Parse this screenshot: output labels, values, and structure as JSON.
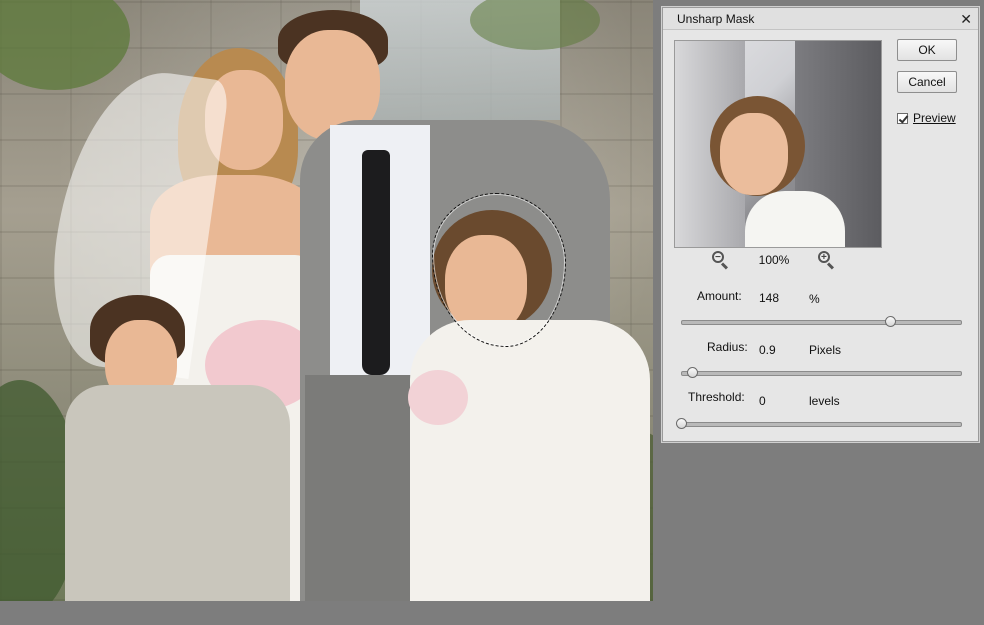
{
  "dialog": {
    "title": "Unsharp Mask",
    "close_glyph": "✕",
    "ok_label": "OK",
    "cancel_label": "Cancel",
    "preview_label": "Preview",
    "preview_checked": true,
    "zoom_level": "100%"
  },
  "params": {
    "amount": {
      "label": "Amount:",
      "value": "148",
      "unit": "%",
      "fraction": 0.75
    },
    "radius": {
      "label": "Radius:",
      "value": "0.9",
      "unit": "Pixels",
      "fraction": 0.04
    },
    "threshold": {
      "label": "Threshold:",
      "value": "0",
      "unit": "levels",
      "fraction": 0.0
    }
  },
  "icons": {
    "zoom_out": "zoom-out-icon",
    "zoom_in": "zoom-in-icon",
    "close": "close-icon"
  },
  "colors": {
    "dialog_bg": "#e6e6e6",
    "workspace_bg": "#7d7d7d"
  }
}
